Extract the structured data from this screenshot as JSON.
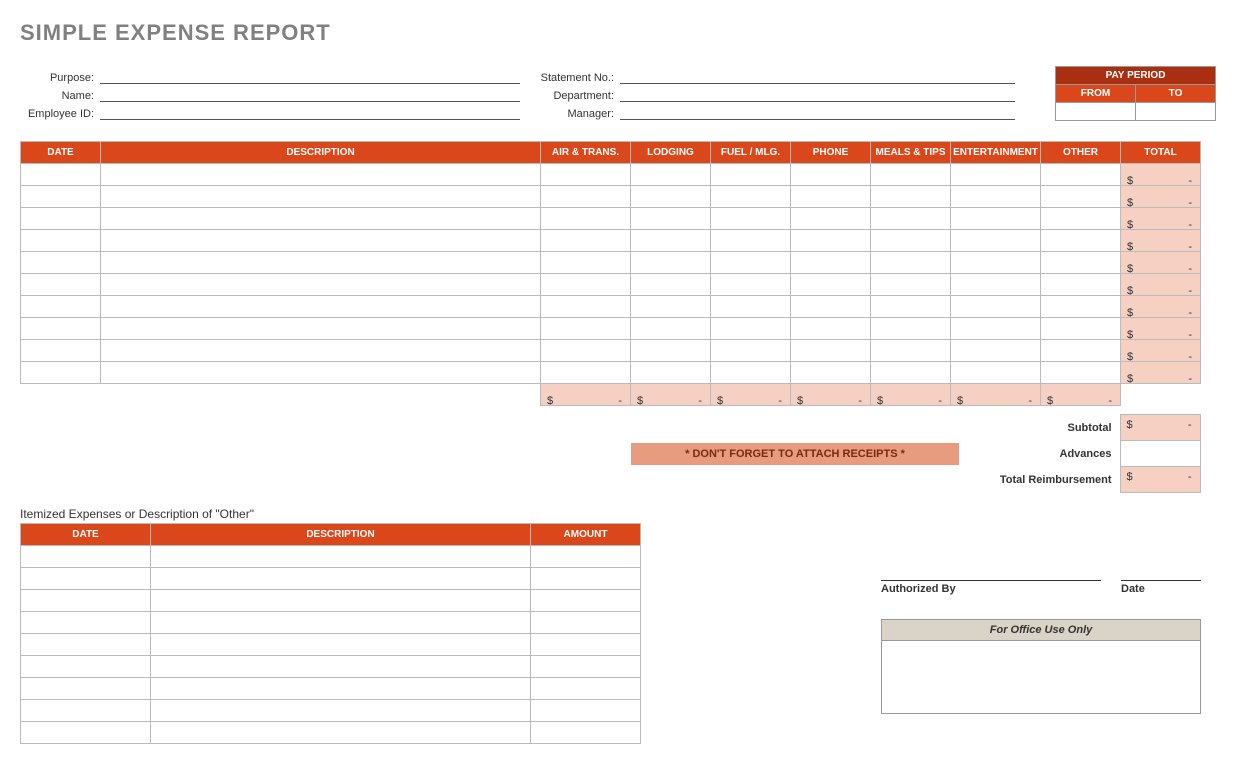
{
  "title": "SIMPLE EXPENSE REPORT",
  "header": {
    "purpose_label": "Purpose:",
    "name_label": "Name:",
    "employee_id_label": "Employee ID:",
    "statement_no_label": "Statement No.:",
    "department_label": "Department:",
    "manager_label": "Manager:"
  },
  "pay_period": {
    "title": "PAY PERIOD",
    "from_label": "FROM",
    "to_label": "TO",
    "from_value": "",
    "to_value": ""
  },
  "columns": {
    "date": "DATE",
    "description": "DESCRIPTION",
    "air_trans": "AIR & TRANS.",
    "lodging": "LODGING",
    "fuel_mlg": "FUEL / MLG.",
    "phone": "PHONE",
    "meals_tips": "MEALS & TIPS",
    "entertainment": "ENTERTAINMENT",
    "other": "OTHER",
    "total": "TOTAL"
  },
  "currency": "$",
  "dash": "-",
  "reminder": "* DON'T FORGET TO ATTACH RECEIPTS *",
  "summary": {
    "subtotal_label": "Subtotal",
    "advances_label": "Advances",
    "total_reimbursement_label": "Total Reimbursement"
  },
  "itemized": {
    "title": "Itemized Expenses or Description of \"Other\"",
    "date": "DATE",
    "description": "DESCRIPTION",
    "amount": "AMOUNT"
  },
  "auth": {
    "authorized_by": "Authorized By",
    "date": "Date"
  },
  "office": {
    "title": "For Office Use Only"
  }
}
